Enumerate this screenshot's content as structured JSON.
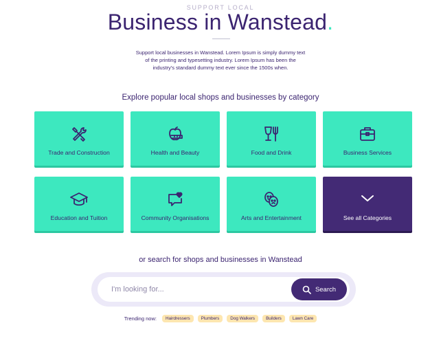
{
  "header": {
    "eyebrow": "SUPPORT LOCAL",
    "title_main": "Business",
    "title_rest": " in Wanstead",
    "title_dot": ".",
    "intro": "Support local businesses in Wanstead. Lorem Ipsum is simply dummy text of the printing and typesetting industry. Lorem Ipsum has been the industry's standard dummy text ever since the 1500s when."
  },
  "categories": {
    "heading": "Explore popular local shops and businesses by category",
    "items": [
      {
        "label": "Trade and Construction",
        "icon": "tools-icon"
      },
      {
        "label": "Health and Beauty",
        "icon": "apple-measure-icon"
      },
      {
        "label": "Food and Drink",
        "icon": "glass-fork-icon"
      },
      {
        "label": "Business Services",
        "icon": "briefcase-icon"
      },
      {
        "label": "Education and Tuition",
        "icon": "graduation-cap-icon"
      },
      {
        "label": "Community Organisations",
        "icon": "chat-heart-icon"
      },
      {
        "label": "Arts and Entertainment",
        "icon": "theatre-masks-icon"
      }
    ],
    "see_all": {
      "label": "See all Categories",
      "icon": "chevron-down-icon"
    }
  },
  "search": {
    "heading": "or search for shops and businesses in Wanstead",
    "placeholder": "I'm looking for...",
    "button_label": "Search"
  },
  "trending": {
    "label": "Trending now:",
    "chips": [
      "Hairdressers",
      "Plumbers",
      "Dog Walkers",
      "Builders",
      "Lawn Care"
    ]
  },
  "colors": {
    "accent_teal": "#3de8bf",
    "brand_purple": "#432a75",
    "chip_yellow": "#fde6b0",
    "search_bg": "#ece9f8"
  }
}
